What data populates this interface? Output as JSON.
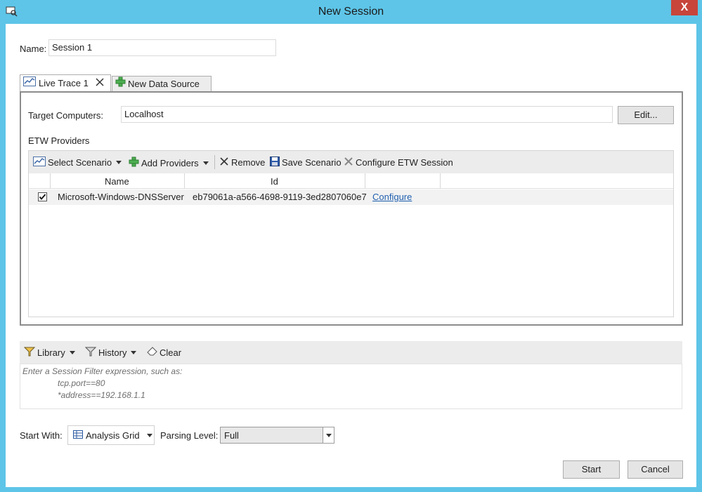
{
  "window": {
    "title": "New Session",
    "close_label": "X"
  },
  "session": {
    "name_label": "Name:",
    "name_value": "Session 1"
  },
  "tabs": [
    {
      "label": "Live Trace 1"
    },
    {
      "label": "New Data Source"
    }
  ],
  "target": {
    "label": "Target Computers:",
    "value": "Localhost",
    "edit_label": "Edit..."
  },
  "etw": {
    "section_label": "ETW Providers",
    "toolbar": {
      "select_scenario": "Select Scenario",
      "add_providers": "Add Providers",
      "remove": "Remove",
      "save_scenario": "Save Scenario",
      "configure_etw": "Configure ETW Session"
    },
    "columns": [
      "Name",
      "Id"
    ],
    "rows": [
      {
        "checked": true,
        "name": "Microsoft-Windows-DNSServer",
        "id": "eb79061a-a566-4698-9119-3ed2807060e7",
        "action": "Configure"
      }
    ]
  },
  "filter": {
    "toolbar": {
      "library": "Library",
      "history": "History",
      "clear": "Clear"
    },
    "hint_line1": "Enter a Session Filter expression, such as:",
    "hint_line2": "tcp.port==80",
    "hint_line3": "*address==192.168.1.1"
  },
  "bottom": {
    "start_with_label": "Start With:",
    "start_with_value": "Analysis Grid",
    "parsing_label": "Parsing Level:",
    "parsing_value": "Full",
    "start_button": "Start",
    "cancel_button": "Cancel"
  },
  "colors": {
    "title_bar": "#5ec5e8",
    "close_button": "#c7453b",
    "link": "#1f5fb0",
    "toolbar_bg": "#ececec"
  }
}
